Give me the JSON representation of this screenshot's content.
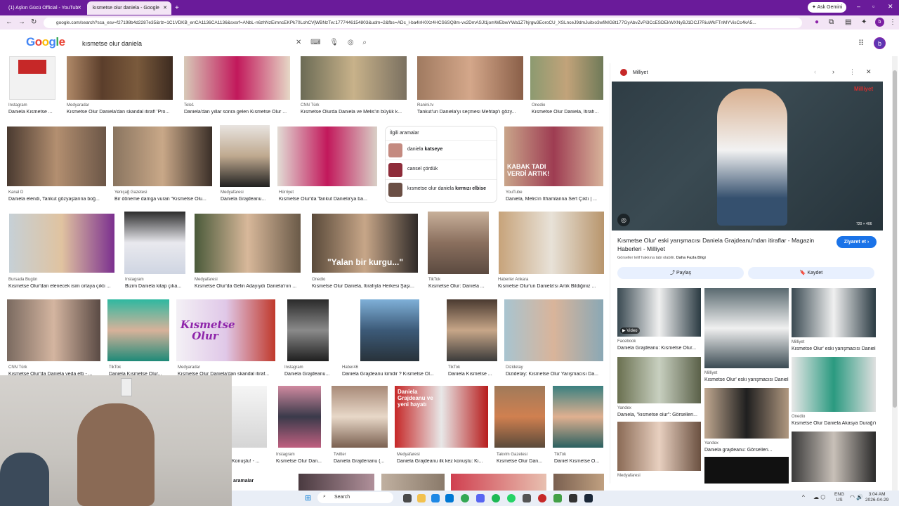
{
  "browser": {
    "tabs": [
      {
        "label": "(1) Aşkın Gücü Official - YouTub"
      },
      {
        "label": "kısmetse olur daniela - Google"
      }
    ],
    "gemini_label": "Ask Gemini",
    "url": "google.com/search?sca_esv=f27198b4d2287e35&rlz=1C1VDKB_enCA1136CA1136&sxsrf=ANbL-n6zhNzEimncEKPk70LohCVjWBNzTw:1777446154803&udm=2&fbs=ADc_l-ba4lrH0Xz4HCS6SQ8m-vx2DmASJl1jomWEbwYWa1Z7hjrgw3EoroCU_XSLnceJ9dmJuitxo3wfiMG8t177GyAbvZvPi3CcESDEkWXNyBJ1DCJ7RiuWkFTnMYVisCc4kA5...",
    "profile_initial": "b"
  },
  "google": {
    "logo": "Google",
    "query": "kısmetse olur daniela",
    "user_initial": "b"
  },
  "grid": {
    "row1": [
      {
        "source": "Instagram",
        "title": "Daniela Kısmetse ..."
      },
      {
        "source": "Medyaradar",
        "title": "Kısmetse Olur Daniela'dan skandal itiraf! 'Pro..."
      },
      {
        "source": "Tele1",
        "title": "Daniela'dan yıllar sonra gelen Kısmetse Olur ..."
      },
      {
        "source": "CNN Türk",
        "title": "Kısmetse Olurda Daniela ve Melis'in büyük k..."
      },
      {
        "source": "Ranini.tv",
        "title": "Tankut'un Daniela'yı seçmesi Mehtap'ı gözy..."
      },
      {
        "source": "Onedio",
        "title": "Kısmetse Olur Daniela, İtirafı..."
      }
    ],
    "row2": [
      {
        "source": "Kanal D",
        "title": "Daniela elendi, Tankut gözyaşlarına boğ..."
      },
      {
        "source": "Yeniçağ Gazetesi",
        "title": "Bir döneme damga vuran \"Kısmetse Olu..."
      },
      {
        "source": "Medyafaresi",
        "title": "Daniela Grajdeanu..."
      },
      {
        "source": "Hürriyet",
        "title": "Kısmetse Olur'da Tankut Daniela'ya ba..."
      },
      {
        "source": "YouTube",
        "title": "Daniela, Melis'in İthamlanna Sert Çıktı | ..."
      }
    ],
    "related": {
      "heading": "İlgili aramalar",
      "items": [
        {
          "normal": "daniela ",
          "bold": "katseye"
        },
        {
          "normal": "cansel çördük",
          "bold": ""
        },
        {
          "normal": "kısmetse olur daniela ",
          "bold": "kırmızı elbise"
        }
      ]
    },
    "row3": [
      {
        "source": "Bursada Bugün",
        "title": "Kısmetse Olur'dan elenecek isim ortaya çıktı ..."
      },
      {
        "source": "Instagram",
        "title": "Bizim Daniela kitap çıka..."
      },
      {
        "source": "Medyafaresi",
        "title": "Kısmetse Olur'da Gelin Adayıydı Daniela'nın ..."
      },
      {
        "source": "Onedio",
        "title": "Kısmetse Olur Daniela, İtirafıyla Herkesi Şaşı..."
      },
      {
        "source": "TikTok",
        "title": "Kısmetse Olur: Daniela ..."
      },
      {
        "source": "Haberler Ankara",
        "title": "Kısmetse Olur'un Daniela'sı Artık Bildiğiniz ..."
      }
    ],
    "row4": [
      {
        "source": "CNN Türk",
        "title": "Kısmetse Olur'da Daniela veda etti - ..."
      },
      {
        "source": "TikTok",
        "title": "Daniela Kısmetse Olur..."
      },
      {
        "source": "Medyaradar",
        "title": "Kısmetse Olur Daniela'dan skandal itiraf..."
      },
      {
        "source": "Instagram",
        "title": "Daniela Grajdeanu..."
      },
      {
        "source": "Haber46",
        "title": "Daniela Grajdeanu kimdir ? Kısmetse Ol..."
      },
      {
        "source": "TikTok",
        "title": "Daniela Kısmetse ..."
      },
      {
        "source": "Dizidetay",
        "title": "Dizidetay: Kısmetse Olur Yarışmacısı Da..."
      }
    ],
    "row5": [
      {
        "source": "",
        "title": "Konuştu! - ..."
      },
      {
        "source": "Instagram",
        "title": "Kısmetse Olur Dan..."
      },
      {
        "source": "Twitter",
        "title": "Daniela Grajdenanu (..."
      },
      {
        "source": "Medyafaresi",
        "title": "Daniela Grajdeanu ilk kez konuştu: Kı..."
      },
      {
        "source": "Takvim Gazetesi",
        "title": "Kısmetse Olur Dan..."
      },
      {
        "source": "TikTok",
        "title": "Daniel Kısmetse O..."
      }
    ],
    "overlays": {
      "yalan": "\"Yalan bir kurgu...\"",
      "kabak": "KABAK TADI VERDİ ARTIK!",
      "kismetse_olur": "Kısmetse Olur",
      "grajdeanu": "Daniela Grajdeanu ve yeni hayatı",
      "aramalar": "aramalar"
    }
  },
  "panel": {
    "source": "Milliyet",
    "title": "Kısmetse Olur' eski yarışmacısı Daniela Grajdeanu'ndan itiraflar - Magazin Haberleri - Milliyet",
    "rights": "Görseller telif hakkına tabi olabilir.",
    "rights_link": "Daha Fazla Bilgi",
    "visit_label": "Ziyaret et",
    "share_label": "Paylaş",
    "save_label": "Kaydet",
    "dimensions": "720 × 406",
    "watermark": "Milliyet",
    "related": [
      {
        "source": "Facebook",
        "title": "Daniela Grajdeanu: Kısmetse Olur...",
        "badge": "Video"
      },
      {
        "source": "Milliyet",
        "title": "Kısmetse Olur' eski yarışmacısı Daniela..."
      },
      {
        "source": "Milliyet",
        "title": "Kısmetse Olur' eski yarışmacısı Daniela..."
      },
      {
        "source": "Yandex",
        "title": "Daniela, \"kısmetse olur\": Görselleri..."
      },
      {
        "source": "Onedio",
        "title": "Kısmetse Olur Daniela Akasya Durağı'n..."
      },
      {
        "source": "Yandex",
        "title": "Daniela grajdeanu: Görselleri..."
      },
      {
        "source": "Medyafaresi",
        "title": ""
      }
    ]
  },
  "taskbar": {
    "search": "Search",
    "lang": "ENG",
    "region": "US",
    "time": "3:04 AM",
    "date": "2026-04-29"
  }
}
